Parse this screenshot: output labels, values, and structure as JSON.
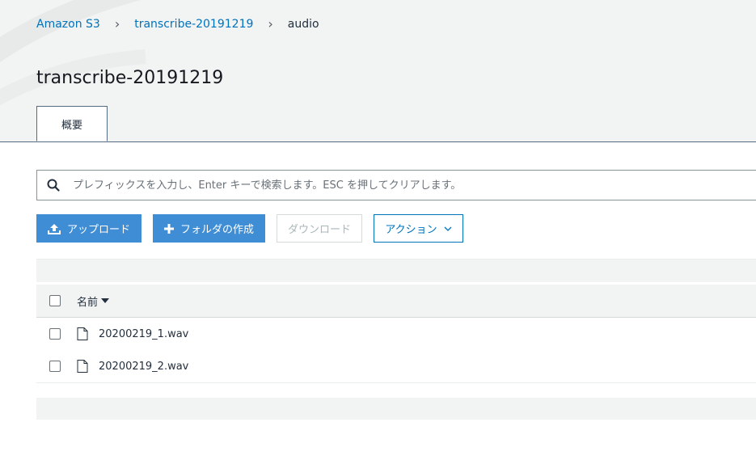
{
  "breadcrumb": {
    "items": [
      {
        "label": "Amazon S3"
      },
      {
        "label": "transcribe-20191219"
      },
      {
        "label": "audio"
      }
    ],
    "separator": "›"
  },
  "page": {
    "title": "transcribe-20191219"
  },
  "tabs": [
    {
      "label": "概要",
      "active": true
    }
  ],
  "search": {
    "placeholder": "プレフィックスを入力し、Enter キーで検索します。ESC を押してクリアします。",
    "icon": "search-icon"
  },
  "toolbar": {
    "upload_label": "アップロード",
    "create_folder_label": "フォルダの作成",
    "download_label": "ダウンロード",
    "actions_label": "アクション"
  },
  "table": {
    "columns": [
      {
        "label": "名前",
        "sort": "descending"
      }
    ],
    "rows": [
      {
        "name": "20200219_1.wav",
        "icon": "file-icon"
      },
      {
        "name": "20200219_2.wav",
        "icon": "file-icon"
      }
    ]
  },
  "colors": {
    "primary": "#3f8ed5",
    "link": "#0073bb",
    "header_bg": "#f2f3f3",
    "text": "#232f3e"
  }
}
